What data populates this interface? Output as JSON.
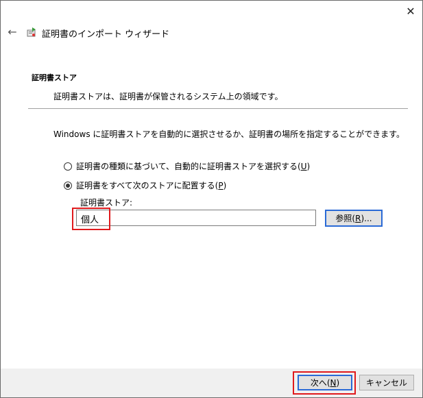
{
  "window": {
    "title": "証明書のインポート ウィザード",
    "close_glyph": "✕",
    "back_glyph": "←"
  },
  "section": {
    "title": "証明書ストア",
    "description": "証明書ストアは、証明書が保管されるシステム上の領域です。"
  },
  "intro": "Windows に証明書ストアを自動的に選択させるか、証明書の場所を指定することができます。",
  "options": [
    {
      "label_before": "証明書の種類に基づいて、自動的に証明書ストアを選択する(",
      "mnemonic": "U",
      "label_after": ")",
      "selected": false
    },
    {
      "label_before": "証明書をすべて次のストアに配置する(",
      "mnemonic": "P",
      "label_after": ")",
      "selected": true
    }
  ],
  "store": {
    "label": "証明書ストア:",
    "value": "個人",
    "browse_before": "参照(",
    "browse_mnemonic": "R",
    "browse_after": ")..."
  },
  "buttons": {
    "next_before": "次へ(",
    "next_mnemonic": "N",
    "next_after": ")",
    "cancel": "キャンセル"
  },
  "colors": {
    "highlight": "#e0191c",
    "focus": "#2a6ad6",
    "footer_bg": "#f0f0f0"
  },
  "icons": [
    "close-icon",
    "back-arrow-icon",
    "certificate-wizard-icon"
  ]
}
